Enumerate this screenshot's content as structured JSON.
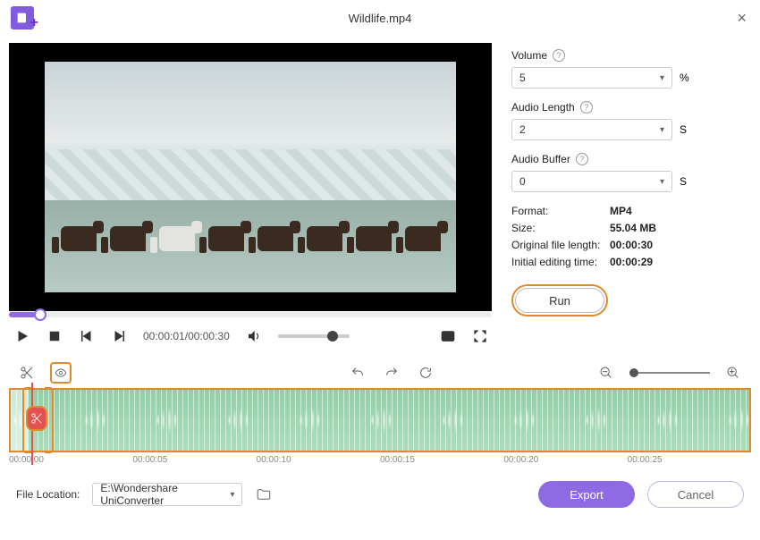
{
  "header": {
    "title": "Wildlife.mp4"
  },
  "player": {
    "current_time": "00:00:01",
    "total_time": "00:00:30"
  },
  "side": {
    "volume_label": "Volume",
    "volume_value": "5",
    "volume_unit": "%",
    "audio_length_label": "Audio Length",
    "audio_length_value": "2",
    "audio_length_unit": "S",
    "audio_buffer_label": "Audio Buffer",
    "audio_buffer_value": "0",
    "audio_buffer_unit": "S",
    "format_label": "Format:",
    "format_value": "MP4",
    "size_label": "Size:",
    "size_value": "55.04 MB",
    "orig_len_label": "Original file length:",
    "orig_len_value": "00:00:30",
    "init_time_label": "Initial editing time:",
    "init_time_value": "00:00:29",
    "run_label": "Run"
  },
  "timeline": {
    "ticks": [
      "00:00:00",
      "00:00:05",
      "00:00:10",
      "00:00:15",
      "00:00:20",
      "00:00:25"
    ]
  },
  "footer": {
    "location_label": "File Location:",
    "location_value": "E:\\Wondershare UniConverter",
    "export_label": "Export",
    "cancel_label": "Cancel"
  }
}
